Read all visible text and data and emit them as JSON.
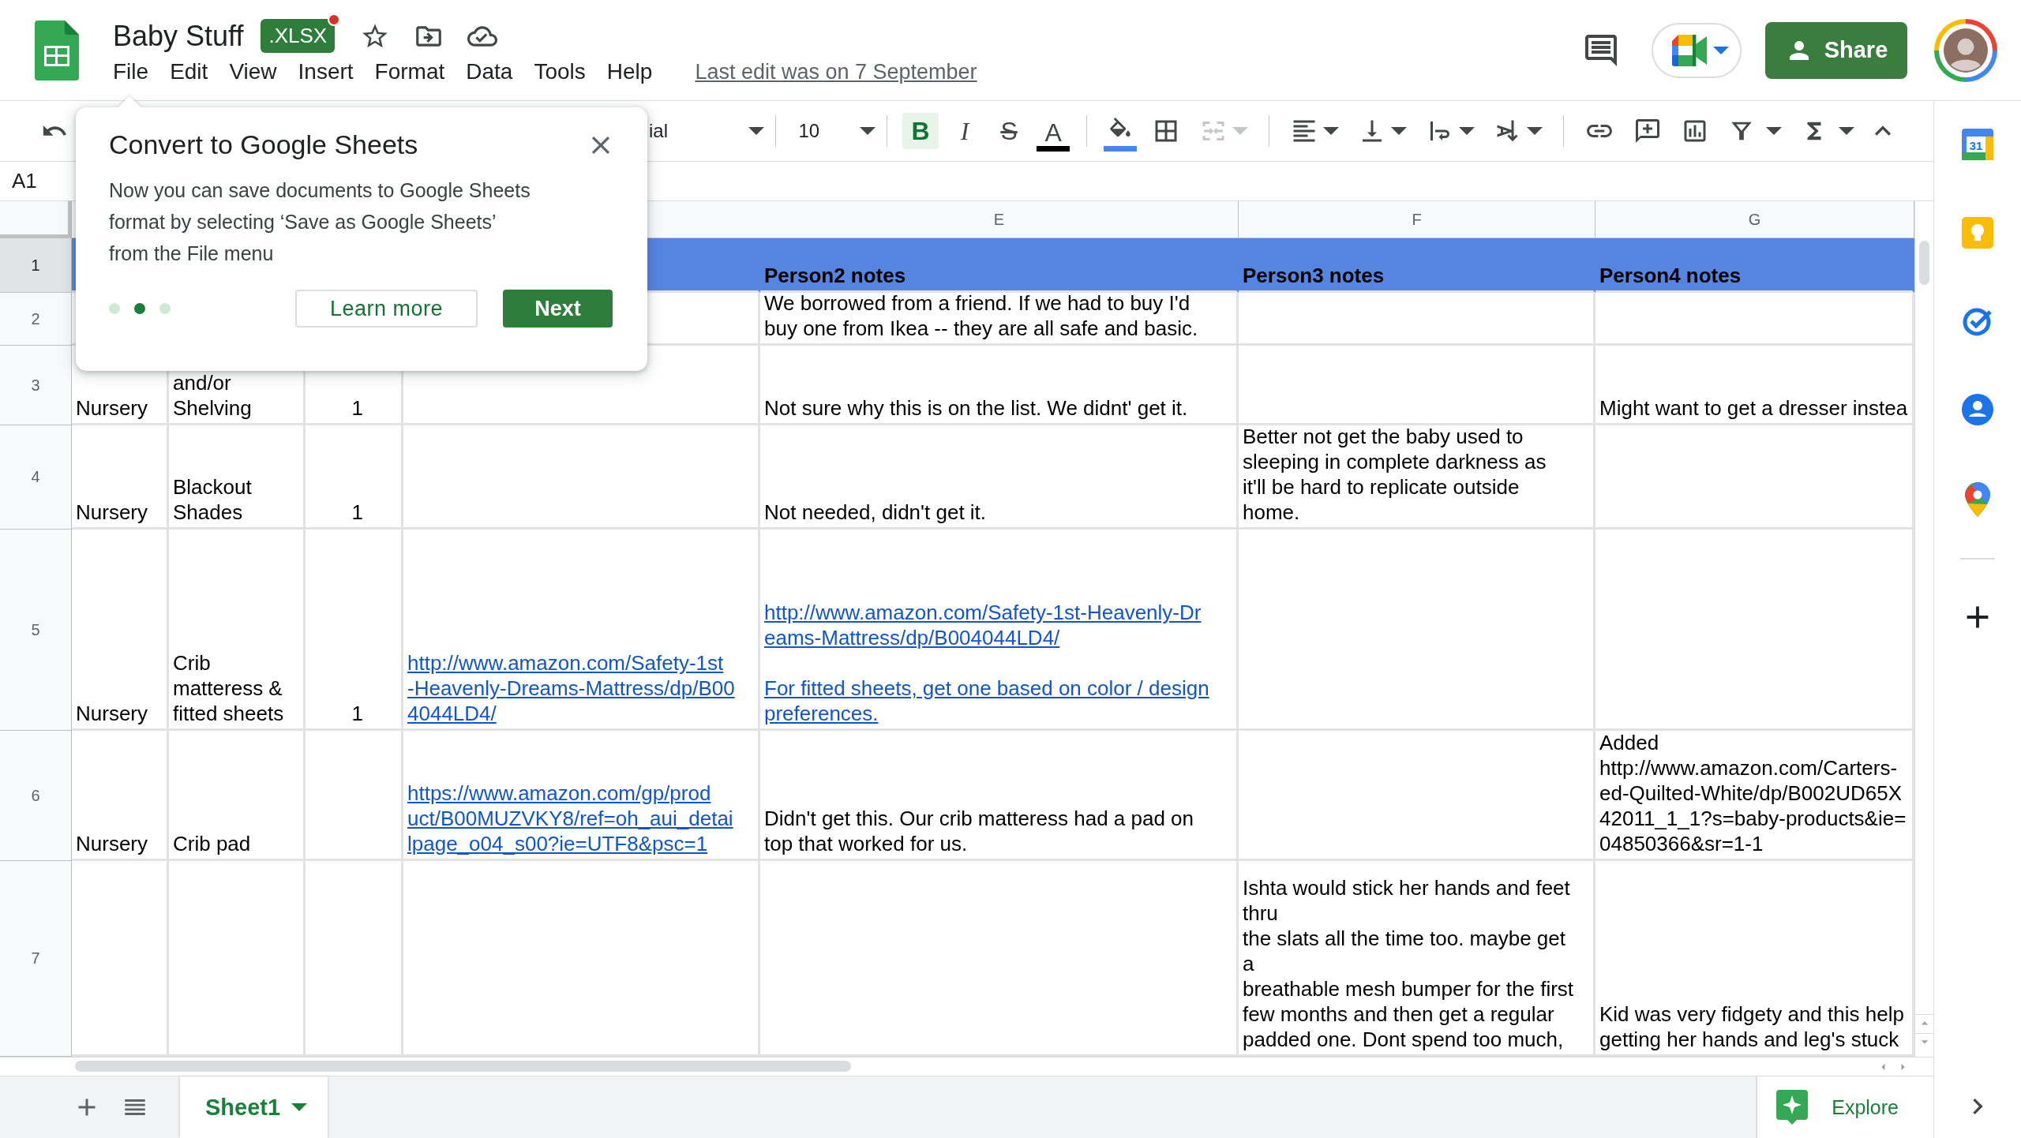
{
  "document": {
    "title": "Baby Stuff",
    "badge": ".XLSX",
    "badge_notification": true,
    "last_edit": "Last edit was on 7 September"
  },
  "menu": [
    "File",
    "Edit",
    "View",
    "Insert",
    "Format",
    "Data",
    "Tools",
    "Help"
  ],
  "share": {
    "label": "Share"
  },
  "toolbar": [
    {
      "kind": "undo"
    },
    {
      "kind": "font",
      "value": "ial"
    },
    {
      "kind": "divider"
    },
    {
      "kind": "size",
      "value": "10"
    },
    {
      "kind": "divider"
    },
    {
      "kind": "bold",
      "label": "B",
      "selected": true
    },
    {
      "kind": "italic",
      "label": "I",
      "selected": false
    },
    {
      "kind": "strike",
      "label": "S",
      "selected": false
    },
    {
      "kind": "text-color",
      "label": "A",
      "color": "#000000"
    },
    {
      "kind": "divider"
    },
    {
      "kind": "fill-color",
      "color": "#4a86e8"
    },
    {
      "kind": "borders"
    },
    {
      "kind": "merge",
      "disabled": true
    },
    {
      "kind": "divider"
    },
    {
      "kind": "halign"
    },
    {
      "kind": "valign"
    },
    {
      "kind": "wrap"
    },
    {
      "kind": "rotate"
    },
    {
      "kind": "divider"
    },
    {
      "kind": "link"
    },
    {
      "kind": "comment"
    },
    {
      "kind": "chart"
    },
    {
      "kind": "filter"
    },
    {
      "kind": "functions"
    },
    {
      "kind": "collapse"
    }
  ],
  "name_box": "A1",
  "columns": [
    null,
    null,
    null,
    null,
    "E",
    "F",
    "G"
  ],
  "rows": [
    {
      "number": "1",
      "selected": true,
      "kind": "header",
      "cells": [
        null,
        null,
        null,
        null,
        {
          "kind": "text",
          "text": "Person2 notes"
        },
        {
          "kind": "text",
          "text": "Person3 notes"
        },
        {
          "kind": "text",
          "text": "Person4 notes"
        }
      ]
    },
    {
      "number": "2",
      "selected": false,
      "kind": "data",
      "cells": [
        null,
        null,
        null,
        null,
        {
          "kind": "text",
          "text": "We borrowed from a friend. If we had to buy I'd\nbuy one from Ikea -- they are all safe and basic."
        },
        null,
        null
      ]
    },
    {
      "number": "3",
      "selected": false,
      "kind": "data",
      "cells": [
        {
          "kind": "text",
          "text": "Nursery"
        },
        {
          "kind": "text",
          "text": "and/or\nShelving"
        },
        {
          "kind": "number",
          "text": "1"
        },
        null,
        {
          "kind": "text",
          "text": "Not sure why this is on the list. We didnt' get it."
        },
        null,
        {
          "kind": "text",
          "text": "Might want to get a dresser instea"
        }
      ]
    },
    {
      "number": "4",
      "selected": false,
      "kind": "data",
      "cells": [
        {
          "kind": "text",
          "text": "Nursery"
        },
        {
          "kind": "text",
          "text": "Blackout\nShades"
        },
        {
          "kind": "number",
          "text": "1"
        },
        null,
        {
          "kind": "text",
          "text": "Not needed, didn't get it."
        },
        {
          "kind": "text",
          "text": "Better not get the baby used to\nsleeping in complete darkness as\nit'll be hard to replicate outside\nhome."
        },
        null
      ]
    },
    {
      "number": "5",
      "selected": false,
      "kind": "data",
      "cells": [
        {
          "kind": "text",
          "text": "Nursery"
        },
        {
          "kind": "text",
          "text": "Crib\nmatteress &\nfitted sheets"
        },
        {
          "kind": "number",
          "text": "1"
        },
        {
          "kind": "link",
          "links": [
            "http://www.amazon.com/Safety-1st\n-Heavenly-Dreams-Mattress/dp/B00\n4044LD4/"
          ]
        },
        {
          "kind": "link",
          "links": [
            "http://www.amazon.com/Safety-1st-Heavenly-Dr\neams-Mattress/dp/B004044LD4/",
            "For fitted sheets, get one based on color / design\npreferences."
          ]
        },
        null,
        null
      ]
    },
    {
      "number": "6",
      "selected": false,
      "kind": "data",
      "cells": [
        {
          "kind": "text",
          "text": "Nursery"
        },
        {
          "kind": "text",
          "text": "Crib pad"
        },
        null,
        {
          "kind": "link",
          "links": [
            "https://www.amazon.com/gp/prod\nuct/B00MUZVKY8/ref=oh_aui_detai\nlpage_o04_s00?ie=UTF8&psc=1"
          ]
        },
        {
          "kind": "text",
          "text": "Didn't get this. Our crib matteress had a pad on\ntop that worked for us."
        },
        null,
        {
          "kind": "text",
          "text": "Added\nhttp://www.amazon.com/Carters-\ned-Quilted-White/dp/B002UD65X\n42011_1_1?s=baby-products&ie=\n04850366&sr=1-1"
        }
      ]
    },
    {
      "number": "7",
      "selected": false,
      "kind": "data",
      "cells": [
        null,
        null,
        null,
        null,
        null,
        {
          "kind": "text",
          "text": "Ishta would stick her hands and feet\nthru\nthe slats all the time too. maybe get\na\nbreathable mesh bumper for the first\nfew months and then get a regular\npadded one. Dont spend too much,"
        },
        {
          "kind": "text",
          "text": "Kid was very fidgety and this help\ngetting her hands and leg's stuck"
        }
      ]
    }
  ],
  "popup": {
    "title": "Convert to Google Sheets",
    "body": "Now you can save documents to Google Sheets\nformat by selecting ‘Save as Google Sheets’\nfrom the File menu",
    "dots": [
      {
        "selected": false
      },
      {
        "selected": true
      },
      {
        "selected": false
      }
    ],
    "secondary": "Learn more",
    "primary": "Next"
  },
  "sheets": [
    {
      "label": "Sheet1",
      "selected": true
    }
  ],
  "explore": "Explore",
  "side_panel": {
    "calendar_day": "31"
  }
}
